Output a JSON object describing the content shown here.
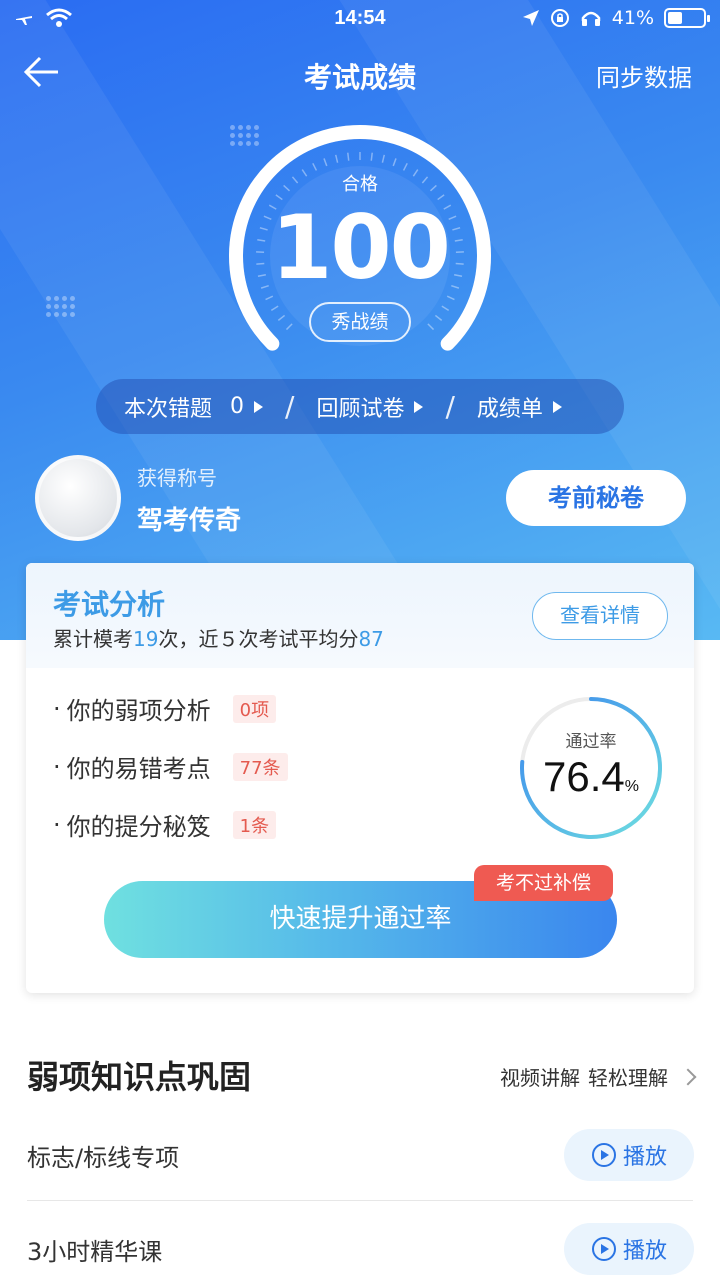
{
  "status_bar": {
    "time": "14:54",
    "battery": "41%",
    "battery_level": 0.41
  },
  "nav": {
    "title": "考试成绩",
    "sync": "同步数据"
  },
  "score": {
    "label": "合格",
    "value": "100",
    "show_button": "秀战绩",
    "gauge_fraction": 1.0
  },
  "pill_bar": {
    "wrong_label": "本次错题",
    "wrong_count": "0",
    "review": "回顾试卷",
    "report": "成绩单",
    "sep": "/"
  },
  "title_section": {
    "label": "获得称号",
    "value": "驾考传奇",
    "secret_button": "考前秘卷"
  },
  "analysis": {
    "title": "考试分析",
    "summary_pre": "累计模考",
    "total": "19",
    "summary_mid": "次，近５次考试平均分",
    "avg": "87",
    "detail_button": "查看详情",
    "rows": [
      {
        "label": "你的弱项分析",
        "badge": "0项"
      },
      {
        "label": "你的易错考点",
        "badge": "77条"
      },
      {
        "label": "你的提分秘笈",
        "badge": "1条"
      }
    ],
    "bullet": "·",
    "pass_rate_label": "通过率",
    "pass_rate": "76.4",
    "pass_rate_unit": "%",
    "pass_rate_value": 76.4,
    "boost_button": "快速提升通过率",
    "compensation_tag": "考不过补偿"
  },
  "weak": {
    "title": "弱项知识点巩固",
    "more_1": "视频讲解",
    "more_2": "轻松理解",
    "courses": [
      {
        "name": "标志/标线专项",
        "play": "播放"
      },
      {
        "name": "3小时精华课",
        "play": "播放"
      }
    ]
  },
  "colors": {
    "accent": "#2a74e4",
    "highlight": "#3d9be6",
    "badge_red": "#e45a4f",
    "tag_red": "#ef5a52"
  }
}
